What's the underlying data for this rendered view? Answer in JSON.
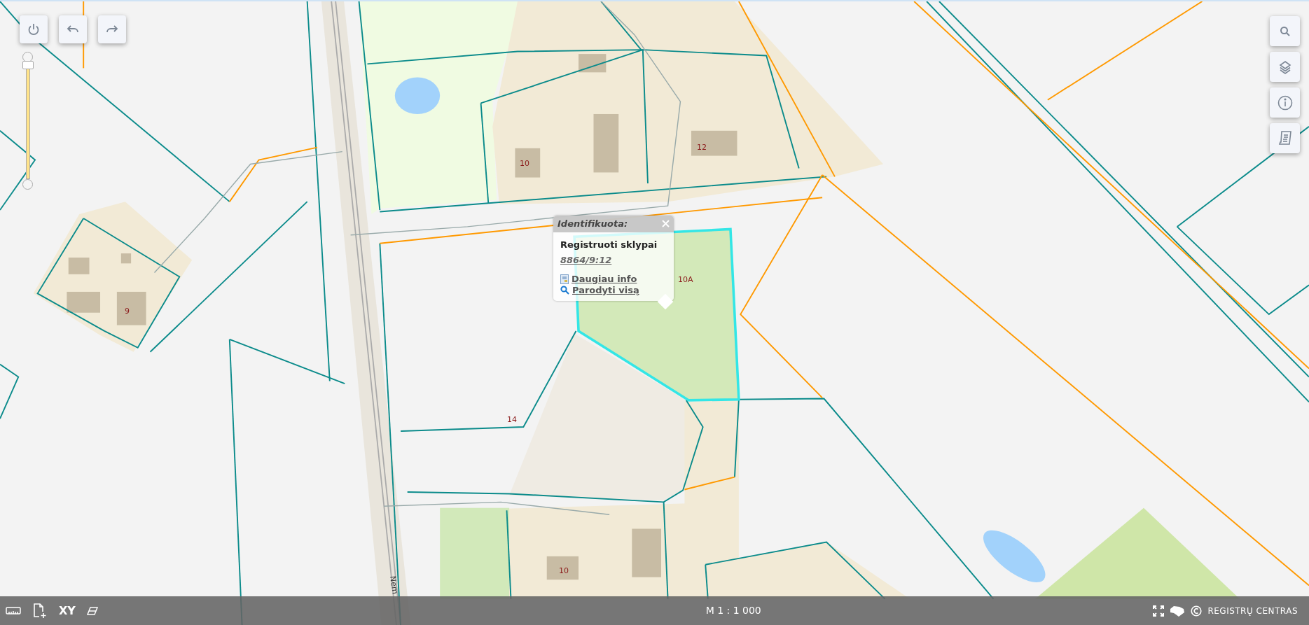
{
  "map": {
    "house_numbers": [
      "10",
      "12",
      "9",
      "14",
      "10A",
      "10"
    ],
    "street_label": "Nem"
  },
  "zoom_slider": {
    "level": 1
  },
  "popup": {
    "title": "Identifikuota:",
    "layer": "Registruoti sklypai",
    "parcel_id": "8864/9:12",
    "links": [
      {
        "kind": "info",
        "label": "Daugiau info"
      },
      {
        "kind": "search",
        "label": "Parodyti visą"
      }
    ]
  },
  "status_bar": {
    "coordinates_tool": "XY",
    "scale": "M 1 : 1 000",
    "brand": "REGISTRŲ CENTRAS"
  }
}
